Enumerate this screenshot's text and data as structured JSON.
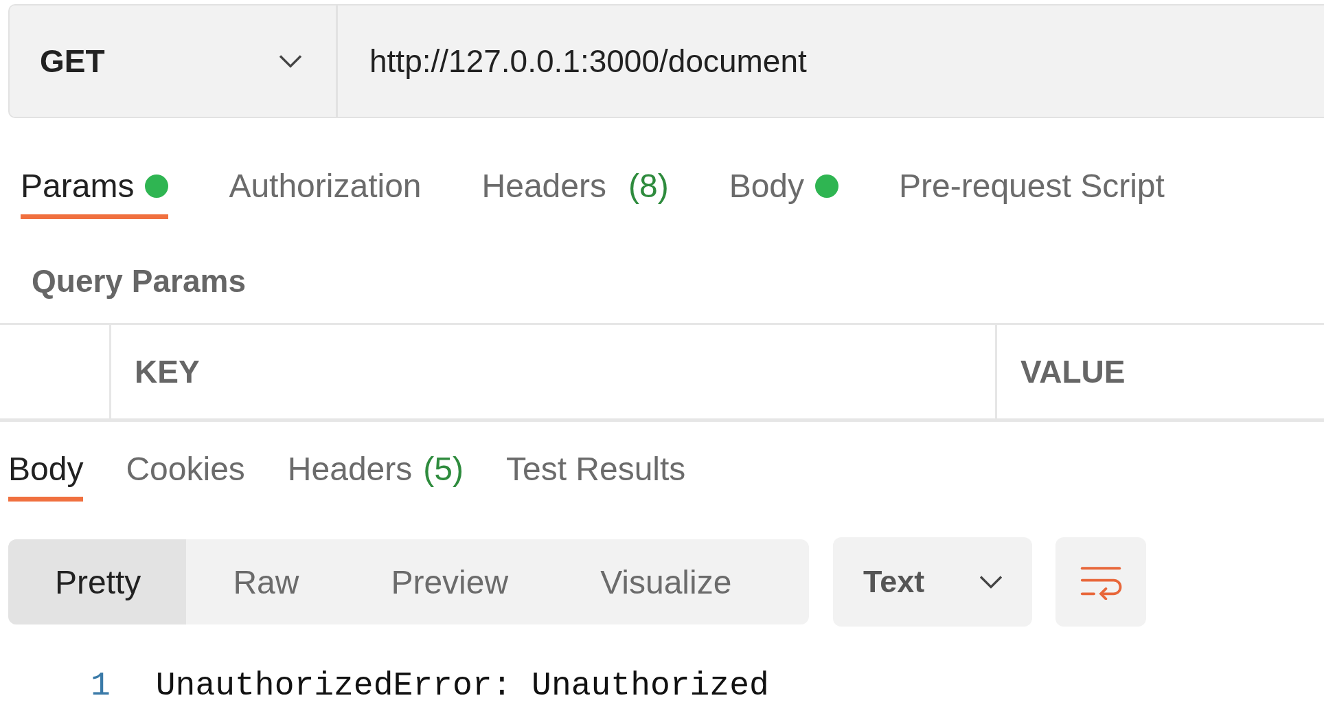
{
  "request": {
    "method": "GET",
    "url": "http://127.0.0.1:3000/document"
  },
  "request_tabs": [
    {
      "label": "Params",
      "selected": true,
      "has_content": true
    },
    {
      "label": "Authorization",
      "selected": false,
      "has_content": false
    },
    {
      "label": "Headers",
      "count": "(8)",
      "selected": false,
      "has_content": false
    },
    {
      "label": "Body",
      "selected": false,
      "has_content": true
    },
    {
      "label": "Pre-request Script",
      "selected": false,
      "has_content": false
    }
  ],
  "query_params": {
    "title": "Query Params",
    "columns": [
      "KEY",
      "VALUE"
    ]
  },
  "response_tabs": [
    {
      "label": "Body",
      "selected": true
    },
    {
      "label": "Cookies",
      "selected": false
    },
    {
      "label": "Headers",
      "count": "(5)",
      "selected": false
    },
    {
      "label": "Test Results",
      "selected": false
    }
  ],
  "view_modes": [
    {
      "label": "Pretty",
      "selected": true
    },
    {
      "label": "Raw",
      "selected": false
    },
    {
      "label": "Preview",
      "selected": false
    },
    {
      "label": "Visualize",
      "selected": false
    }
  ],
  "format": "Text",
  "lines": [
    {
      "number": "1",
      "text": "UnauthorizedError: Unauthorized"
    }
  ]
}
